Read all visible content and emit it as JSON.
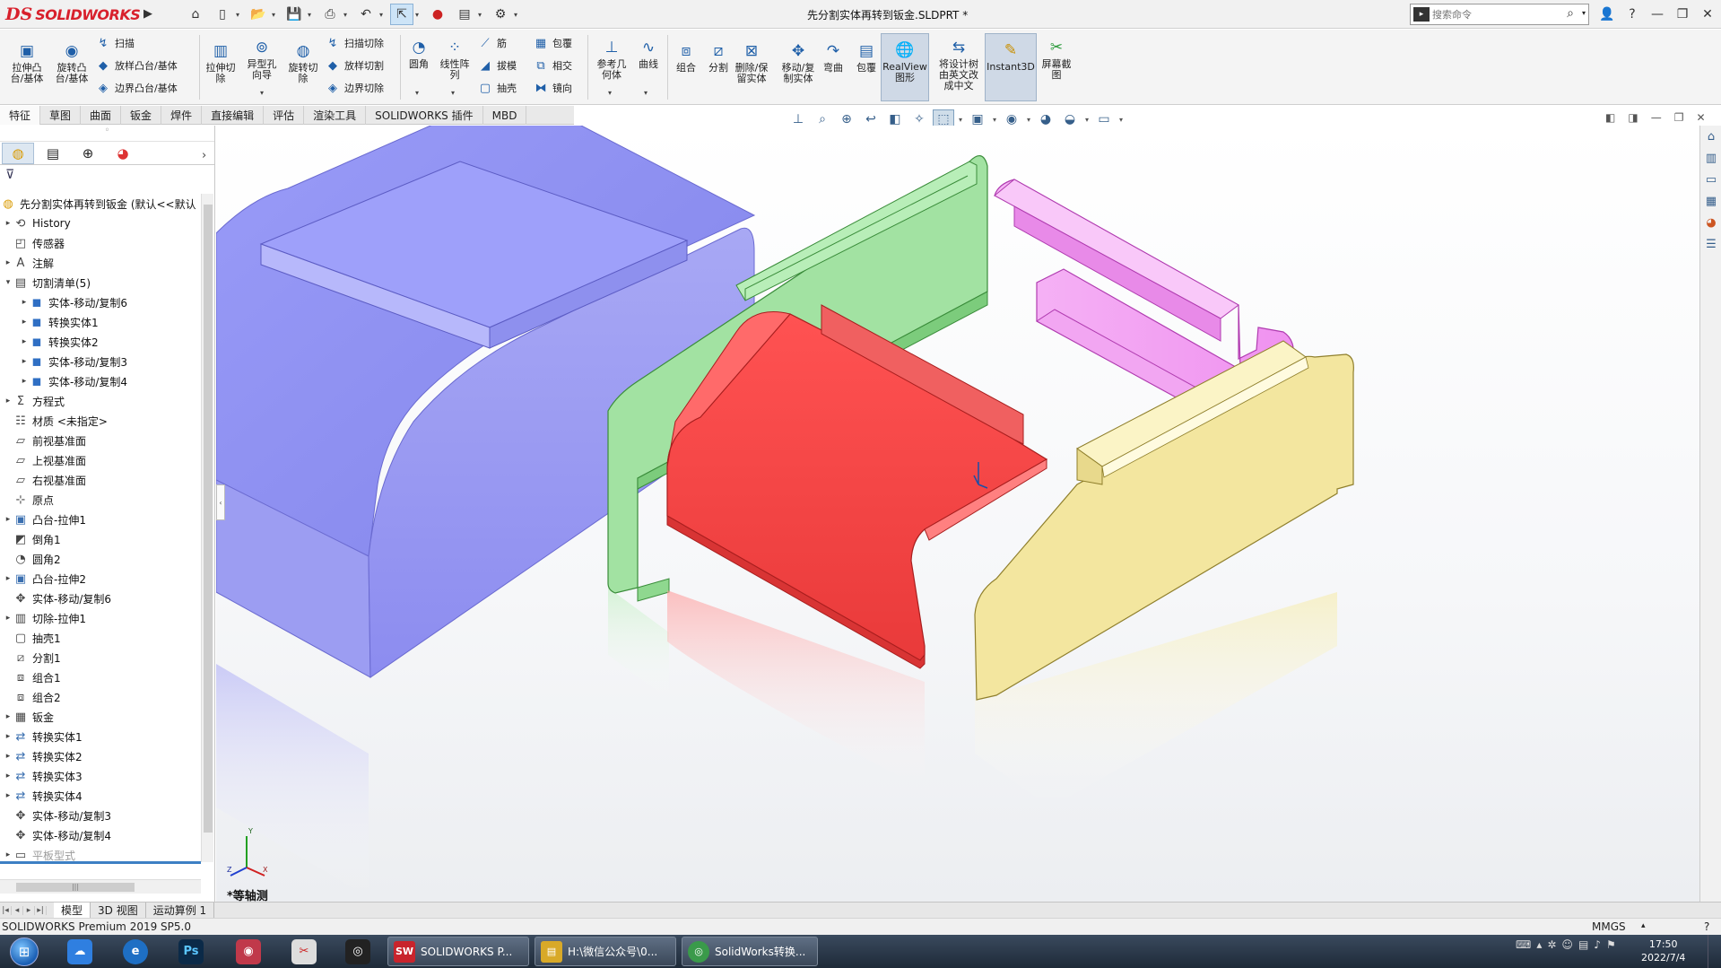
{
  "app": {
    "logo_ds": "DS",
    "logo_name": "SOLIDWORKS",
    "document_title": "先分割实体再转到钣金.SLDPRT *",
    "search_placeholder": "搜索命令"
  },
  "ribbon": {
    "extrude_boss": "拉伸凸\n台/基体",
    "revolve_boss": "旋转凸\n台/基体",
    "sweep": "扫描",
    "loft": "放样凸台/基体",
    "boundary": "边界凸台/基体",
    "extrude_cut": "拉伸切\n除",
    "hole_wizard": "异型孔\n向导",
    "revolve_cut": "旋转切\n除",
    "sweep_cut": "扫描切除",
    "loft_cut": "放样切割",
    "boundary_cut": "边界切除",
    "fillet": "圆角",
    "linear_pattern": "线性阵\n列",
    "rib": "筋",
    "draft": "拔模",
    "shell": "抽壳",
    "wrap": "包覆",
    "intersect": "相交",
    "mirror": "镜向",
    "ref_geometry": "参考几\n何体",
    "curves": "曲线",
    "combine": "组合",
    "split": "分割",
    "delete_keep": "删除/保\n留实体",
    "move_copy": "移动/复\n制实体",
    "flex": "弯曲",
    "wrap2": "包覆",
    "realview": "RealView\n图形",
    "translate": "将设计树\n由英文改\n成中文",
    "instant3d": "Instant3D",
    "screenshot": "屏幕截\n图"
  },
  "tabs": [
    "特征",
    "草图",
    "曲面",
    "钣金",
    "焊件",
    "直接编辑",
    "评估",
    "渲染工具",
    "SOLIDWORKS 插件",
    "MBD"
  ],
  "tree": {
    "root": "先分割实体再转到钣金 (默认<<默认",
    "items": [
      {
        "label": "History",
        "icon": "history-icon",
        "expander": "▸",
        "indent": 0
      },
      {
        "label": "传感器",
        "icon": "sensor-icon",
        "expander": "",
        "indent": 0
      },
      {
        "label": "注解",
        "icon": "annotation-icon",
        "expander": "▸",
        "indent": 0
      },
      {
        "label": "切割清单(5)",
        "icon": "cutlist-icon",
        "expander": "▾",
        "indent": 0
      },
      {
        "label": "实体-移动/复制6",
        "icon": "solid-body-icon",
        "expander": "▸",
        "indent": 1
      },
      {
        "label": "转换实体1",
        "icon": "solid-body-icon",
        "expander": "▸",
        "indent": 1
      },
      {
        "label": "转换实体2",
        "icon": "solid-body-icon",
        "expander": "▸",
        "indent": 1
      },
      {
        "label": "实体-移动/复制3",
        "icon": "solid-body-icon",
        "expander": "▸",
        "indent": 1
      },
      {
        "label": "实体-移动/复制4",
        "icon": "solid-body-icon",
        "expander": "▸",
        "indent": 1
      },
      {
        "label": "方程式",
        "icon": "equation-icon",
        "expander": "▸",
        "indent": 0
      },
      {
        "label": "材质 <未指定>",
        "icon": "material-icon",
        "expander": "",
        "indent": 0
      },
      {
        "label": "前视基准面",
        "icon": "plane-icon",
        "expander": "",
        "indent": 0
      },
      {
        "label": "上视基准面",
        "icon": "plane-icon",
        "expander": "",
        "indent": 0
      },
      {
        "label": "右视基准面",
        "icon": "plane-icon",
        "expander": "",
        "indent": 0
      },
      {
        "label": "原点",
        "icon": "origin-icon",
        "expander": "",
        "indent": 0
      },
      {
        "label": "凸台-拉伸1",
        "icon": "extrude-feature-icon",
        "expander": "▸",
        "indent": 0
      },
      {
        "label": "倒角1",
        "icon": "chamfer-icon",
        "expander": "",
        "indent": 0
      },
      {
        "label": "圆角2",
        "icon": "fillet-icon",
        "expander": "",
        "indent": 0
      },
      {
        "label": "凸台-拉伸2",
        "icon": "extrude-feature-icon",
        "expander": "▸",
        "indent": 0
      },
      {
        "label": "实体-移动/复制6",
        "icon": "move-copy-icon",
        "expander": "",
        "indent": 0
      },
      {
        "label": "切除-拉伸1",
        "icon": "cut-extrude-icon",
        "expander": "▸",
        "indent": 0
      },
      {
        "label": "抽壳1",
        "icon": "shell-icon",
        "expander": "",
        "indent": 0
      },
      {
        "label": "分割1",
        "icon": "split-icon",
        "expander": "",
        "indent": 0
      },
      {
        "label": "组合1",
        "icon": "combine-icon",
        "expander": "",
        "indent": 0
      },
      {
        "label": "组合2",
        "icon": "combine-icon",
        "expander": "",
        "indent": 0
      },
      {
        "label": "钣金",
        "icon": "sheetmetal-icon",
        "expander": "▸",
        "indent": 0
      },
      {
        "label": "转换实体1",
        "icon": "convert-body-icon",
        "expander": "▸",
        "indent": 0
      },
      {
        "label": "转换实体2",
        "icon": "convert-body-icon",
        "expander": "▸",
        "indent": 0
      },
      {
        "label": "转换实体3",
        "icon": "convert-body-icon",
        "expander": "▸",
        "indent": 0
      },
      {
        "label": "转换实体4",
        "icon": "convert-body-icon",
        "expander": "▸",
        "indent": 0
      },
      {
        "label": "实体-移动/复制3",
        "icon": "move-copy-icon",
        "expander": "",
        "indent": 0
      },
      {
        "label": "实体-移动/复制4",
        "icon": "move-copy-icon",
        "expander": "",
        "indent": 0
      },
      {
        "label": "平板型式",
        "icon": "flat-pattern-icon",
        "expander": "▸",
        "indent": 0,
        "dim": true
      }
    ]
  },
  "viewport": {
    "view_label": "*等轴测",
    "triad_x": "X",
    "triad_y": "Y",
    "triad_z": "Z"
  },
  "bottom_tabs": [
    "模型",
    "3D 视图",
    "运动算例 1"
  ],
  "status": {
    "text": "SOLIDWORKS Premium 2019 SP5.0",
    "units": "MMGS",
    "help": "?"
  },
  "taskbar": {
    "tasks": [
      {
        "label": "SOLIDWORKS P...",
        "icon_text": "SW"
      },
      {
        "label": "H:\\微信公众号\\0...",
        "icon_text": "▤"
      },
      {
        "label": "SolidWorks转换...",
        "icon_text": "◎"
      }
    ],
    "time": "17:50",
    "date": "2022/7/4"
  },
  "colors": {
    "purple_body": "#8a8cf0",
    "green_body": "#9fe09f",
    "red_body": "#f24545",
    "pink_body": "#f3a2f3",
    "yellow_body": "#f1e49c",
    "accent": "#d8202c"
  }
}
